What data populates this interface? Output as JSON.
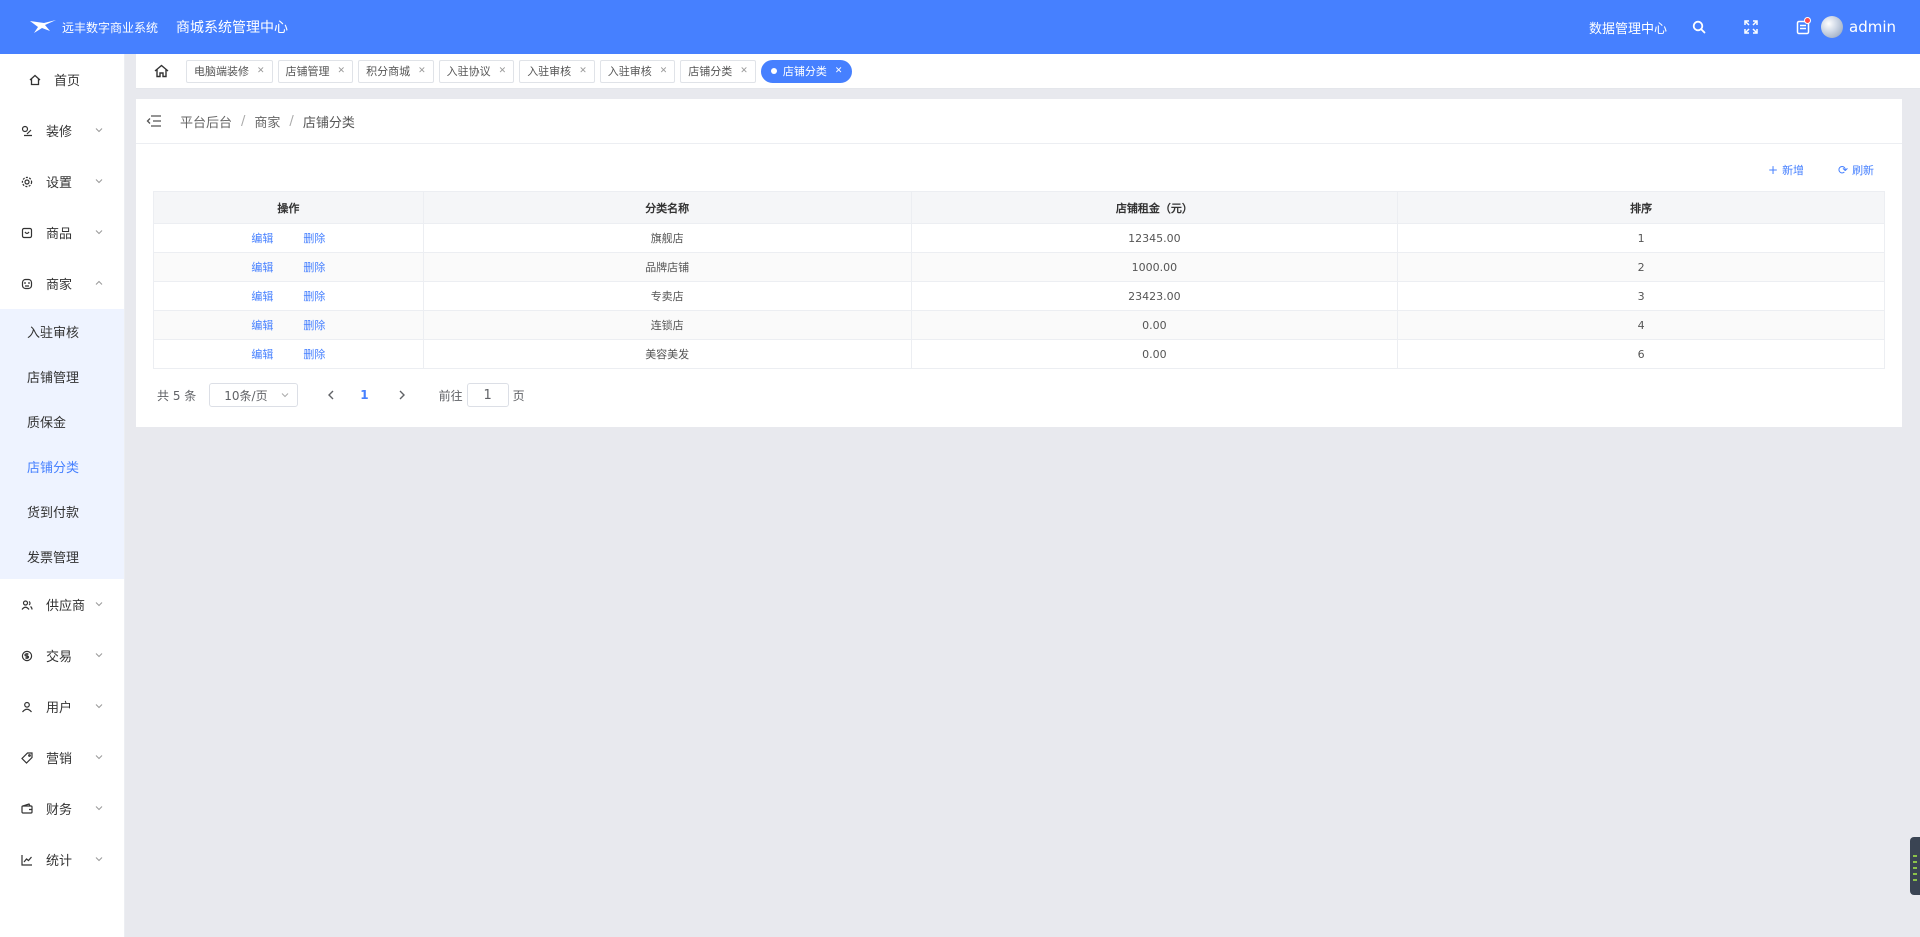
{
  "header": {
    "logo_text": "远丰数字商业系统",
    "app_title": "商城系统管理中心",
    "data_center": "数据管理中心",
    "username": "admin"
  },
  "sidebar": {
    "home": "首页",
    "items_top": [
      {
        "label": "装修",
        "icon": "decorate-icon"
      },
      {
        "label": "设置",
        "icon": "gear-icon"
      },
      {
        "label": "商品",
        "icon": "product-icon"
      },
      {
        "label": "商家",
        "icon": "store-icon"
      }
    ],
    "merchant_sub": [
      "入驻审核",
      "店铺管理",
      "质保金",
      "店铺分类",
      "货到付款",
      "发票管理"
    ],
    "active_sub": "店铺分类",
    "items_bottom": [
      {
        "label": "供应商",
        "icon": "supplier-icon"
      },
      {
        "label": "交易",
        "icon": "trade-icon"
      },
      {
        "label": "用户",
        "icon": "user-icon"
      },
      {
        "label": "营销",
        "icon": "tag-icon"
      },
      {
        "label": "财务",
        "icon": "wallet-icon"
      },
      {
        "label": "统计",
        "icon": "chart-icon"
      }
    ]
  },
  "tabs": [
    "电脑端装修",
    "店铺管理",
    "积分商城",
    "入驻协议",
    "入驻审核",
    "入驻审核",
    "店铺分类"
  ],
  "active_tab": "店铺分类",
  "breadcrumb": [
    "平台后台",
    "商家",
    "店铺分类"
  ],
  "toolbar": {
    "add_label": "新增",
    "refresh_label": "刷新"
  },
  "table": {
    "columns": [
      "操作",
      "分类名称",
      "店铺租金（元）",
      "排序"
    ],
    "edit_label": "编辑",
    "delete_label": "删除",
    "rows": [
      {
        "name": "旗舰店",
        "rent": "12345.00",
        "sort": "1"
      },
      {
        "name": "品牌店铺",
        "rent": "1000.00",
        "sort": "2"
      },
      {
        "name": "专卖店",
        "rent": "23423.00",
        "sort": "3"
      },
      {
        "name": "连锁店",
        "rent": "0.00",
        "sort": "4"
      },
      {
        "name": "美容美发",
        "rent": "0.00",
        "sort": "6"
      }
    ]
  },
  "pager": {
    "total": "共 5 条",
    "page_size": "10条/页",
    "current_page": "1",
    "goto_label": "前往",
    "goto_value": "1",
    "page_suffix": "页"
  },
  "colors": {
    "primary": "#4680ff",
    "submenu_bg": "#eef3ff",
    "content_bg": "#e8e9ee"
  }
}
